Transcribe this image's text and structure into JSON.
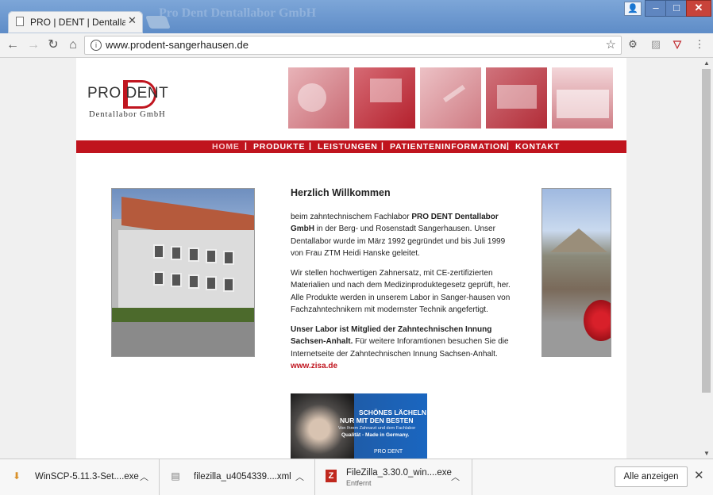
{
  "browser": {
    "tab_title": "PRO | DENT | Dentallabor GmbH",
    "tab_close": "✕",
    "url": "www.prodent-sangerhausen.de",
    "background_window_title": "Pro Dent Dentallabor GmbH"
  },
  "header": {
    "logo_text": "PRO  DENT",
    "logo_subtitle": "Dentallabor GmbH"
  },
  "nav": {
    "items": [
      "HOME",
      "PRODUKTE",
      "LEISTUNGEN",
      "PATIENTENINFORMATION",
      "KONTAKT"
    ],
    "separator": "|"
  },
  "content": {
    "heading": "Herzlich Willkommen",
    "p1_prefix": "beim zahntechnischem Fachlabor ",
    "p1_bold": "PRO DENT Dentallabor GmbH",
    "p1_suffix": " in der Berg- und Rosenstadt Sangerhausen. Unser Dentallabor wurde im März 1992 gegründet und bis Juli 1999 von Frau ZTM Heidi Hanske geleitet.",
    "p2": "Wir stellen hochwertigen Zahnersatz, mit CE-zertifizierten Materialien und nach dem Medizinproduktegesetz geprüft, her. Alle Produkte werden in unserem Labor in Sanger-hausen von Fachzahntechnikern mit modernster Technik angefertigt.",
    "p3_bold": "Unser Labor ist Mitglied der Zahntechnischen Innung Sachsen-Anhalt.",
    "p3_text": " Für weitere Inforamtionen besuchen Sie die Internetseite der Zahntechnischen Innung Sachsen-Anhalt. ",
    "p3_link": "www.zisa.de"
  },
  "promo": {
    "line1": "SCHÖNES LÄCHELN",
    "line2": "NUR MIT DEN BESTEN",
    "line3": "Von Ihrem Zahnarzt und dem Fachlabor",
    "line4": "Qualität - Made in Germany.",
    "logo": "PRO DENT"
  },
  "downloads": {
    "items": [
      {
        "name": "WinSCP-5.11.3-Set....exe",
        "status": ""
      },
      {
        "name": "filezilla_u4054339....xml",
        "status": ""
      },
      {
        "name": "FileZilla_3.30.0_win....exe",
        "status": "Entfernt"
      }
    ],
    "show_all": "Alle anzeigen"
  },
  "colors": {
    "brand_red": "#c0141e",
    "toolbar": "#f2f2f2",
    "title_bar": "#6e98cf"
  }
}
